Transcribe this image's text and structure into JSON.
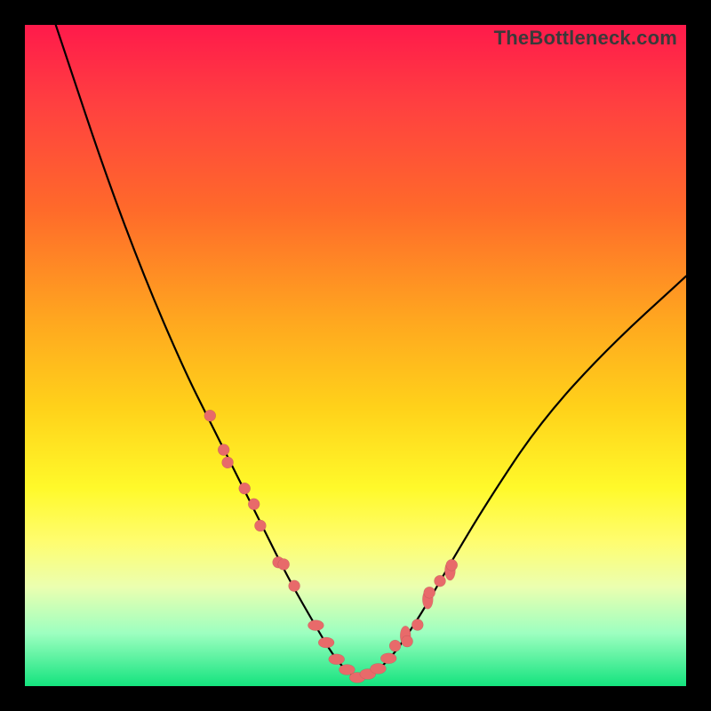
{
  "branding": {
    "watermark": "TheBottleneck.com"
  },
  "chart_data": {
    "type": "line",
    "title": "",
    "xlabel": "",
    "ylabel": "",
    "xlim": [
      0,
      100
    ],
    "ylim": [
      0,
      100
    ],
    "grid": false,
    "legend": false,
    "series": [
      {
        "name": "bottleneck-curve",
        "x": [
          0,
          6,
          12,
          18,
          24,
          28,
          32,
          36,
          40,
          44,
          47,
          50,
          53,
          56,
          60,
          64,
          70,
          78,
          88,
          100
        ],
        "values": [
          114,
          96,
          78,
          62,
          48,
          40,
          32,
          24,
          16,
          9,
          4,
          1,
          2,
          5,
          11,
          18,
          28,
          40,
          51,
          62
        ]
      }
    ],
    "markers": {
      "left_cluster": {
        "x_range": [
          28,
          41
        ],
        "y_range": [
          10,
          32
        ],
        "count": 9
      },
      "bottom_cluster": {
        "x_range": [
          44,
          55
        ],
        "y_range": [
          0,
          4
        ],
        "count": 8
      },
      "right_cluster": {
        "x_range": [
          56,
          65
        ],
        "y_range": [
          6,
          22
        ],
        "count": 9
      }
    },
    "background_gradient": {
      "direction": "top-to-bottom",
      "stops": [
        {
          "pct": 0,
          "color": "#ff1a4b"
        },
        {
          "pct": 28,
          "color": "#ff6a2a"
        },
        {
          "pct": 58,
          "color": "#ffd21a"
        },
        {
          "pct": 78,
          "color": "#fffd6e"
        },
        {
          "pct": 100,
          "color": "#14e37e"
        }
      ]
    }
  }
}
